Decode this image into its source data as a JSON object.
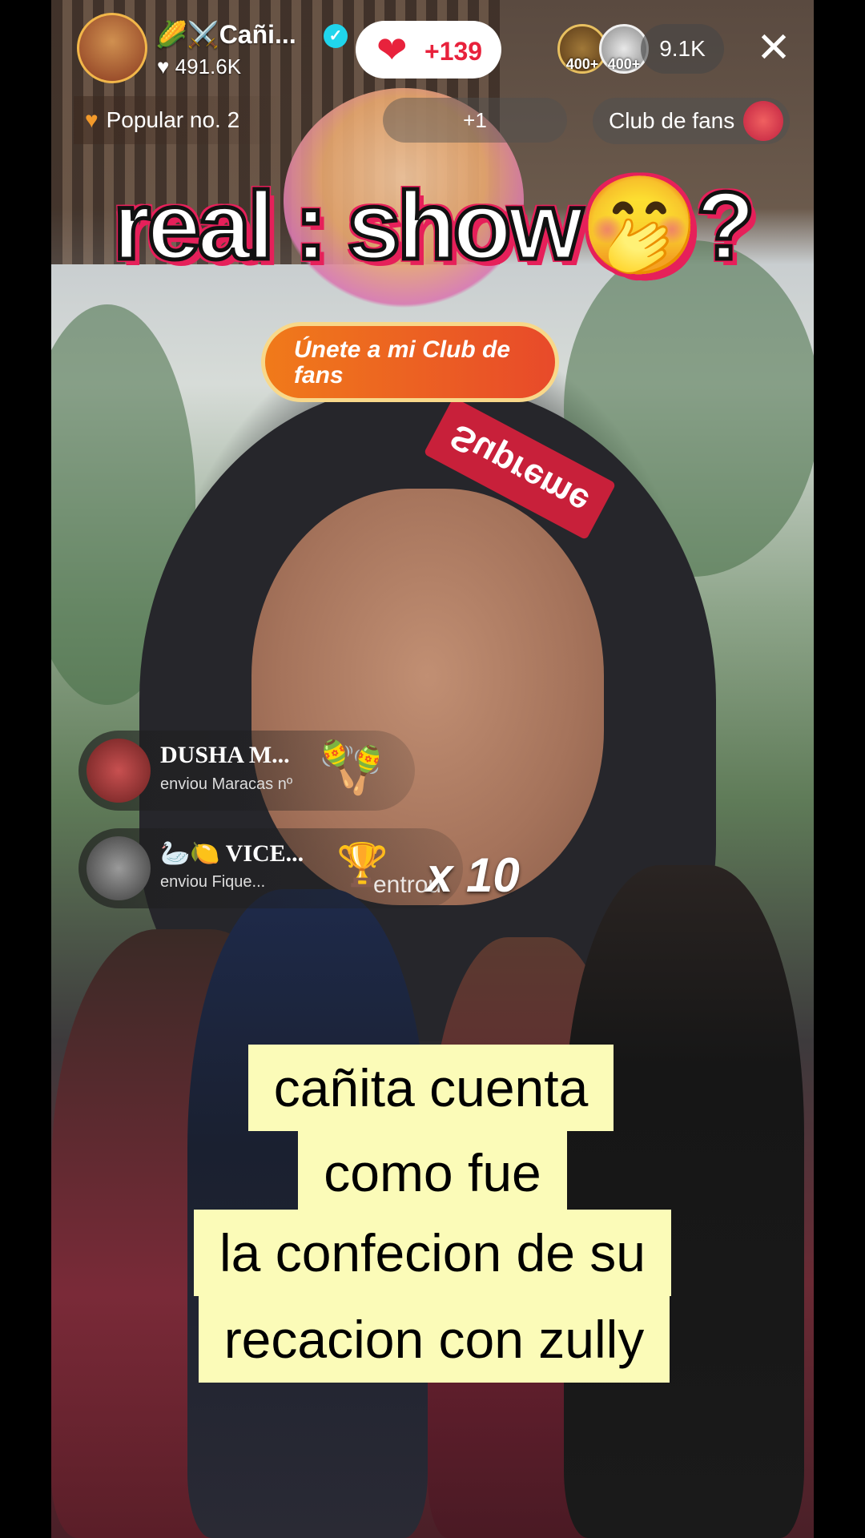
{
  "host": {
    "name": "🌽⚔️Cañi...",
    "likes": "491.6K",
    "verified_icon": "check-icon"
  },
  "like_button": {
    "icon": "heart-icon",
    "count": "+139"
  },
  "viewers": {
    "top": [
      {
        "rank": "400+",
        "color": "#c9a050"
      },
      {
        "rank": "400+",
        "color": "#d8d8d8"
      }
    ],
    "count": "9.1K"
  },
  "close_icon": "✕",
  "badges": {
    "popular": "Popular no. 2",
    "plus_one": "+1",
    "fan_club": "Club de fans"
  },
  "headline": "real : show🤭?",
  "join_button": "Únete a mi Club de fans",
  "gifts": [
    {
      "name": "DUSHA M...",
      "action": "enviou Maracas nº",
      "item": "🪇",
      "avatar_color": "#8a3030"
    },
    {
      "name": "🦢🍋 VICE...",
      "action": "enviou Fique...",
      "item": "🏆",
      "avatar_color": "#6a6a6a"
    }
  ],
  "combo": "x 10",
  "entry_text": "entrou",
  "caption_lines": [
    "cañita cuenta",
    "como fue",
    "la confecion de su",
    "recacion con zully"
  ],
  "colors": {
    "accent_pink": "#e6205a",
    "like_red": "#e8223c",
    "caption_bg": "#fbfbb8",
    "join_orange": "#f07a1a"
  }
}
